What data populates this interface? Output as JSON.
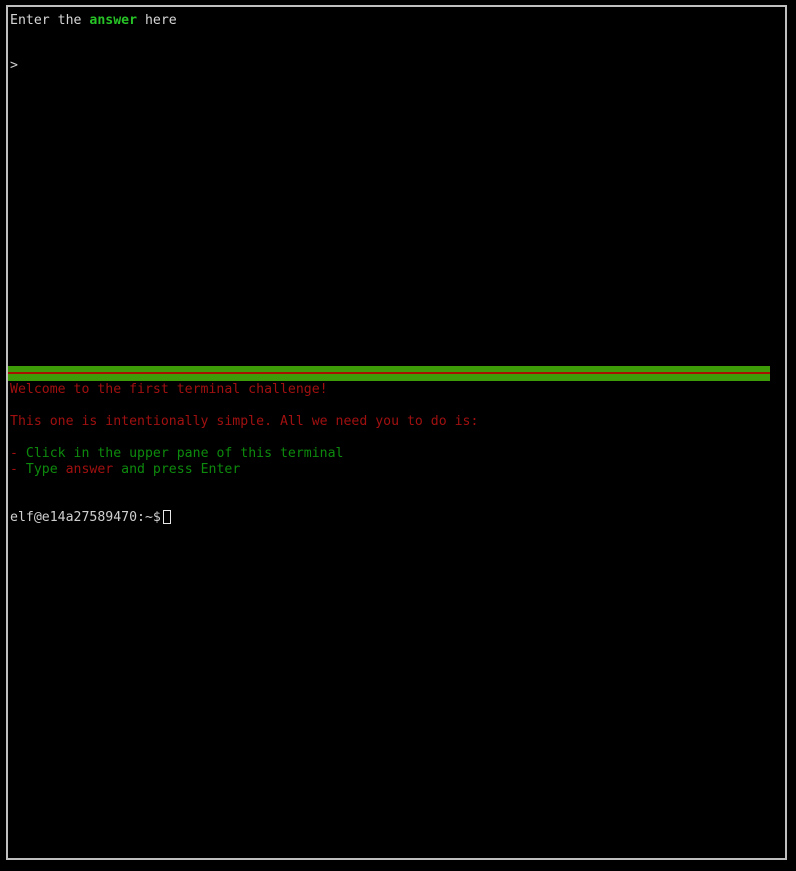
{
  "window": {
    "border_color": "#bfbfbf",
    "background": "#000000"
  },
  "upper_pane": {
    "name": "answer-input-pane",
    "prompt_line": {
      "prefix": "Enter the ",
      "highlight": "answer",
      "suffix": " here"
    },
    "input_caret": ">",
    "input_value": ""
  },
  "separator": {
    "bar_color": "#3e9c08",
    "line_color": "#a81000"
  },
  "lower_pane": {
    "name": "shell-output-pane",
    "lines": [
      {
        "id": "welcome",
        "text": "Welcome to the first terminal challenge!",
        "color": "red"
      },
      {
        "id": "blank-1",
        "text": "",
        "color": "red"
      },
      {
        "id": "intro",
        "text": "This one is intentionally simple. All we need you to do is:",
        "color": "red"
      },
      {
        "id": "blank-2",
        "text": "",
        "color": "red"
      }
    ],
    "bullets": [
      {
        "id": "bullet-click",
        "dash": "-",
        "text": " Click in the upper pane of this terminal"
      },
      {
        "id": "bullet-type",
        "dash": "-",
        "pre": " Type ",
        "keyword": "answer",
        "post": " and press Enter"
      }
    ],
    "shell_prompt": {
      "user": "elf",
      "at": "@",
      "host": "e14a27589470",
      "separator": ":",
      "path": "~",
      "sigil": "$",
      "full": "elf@e14a27589470:~$"
    }
  },
  "colors": {
    "accent_green": "#26c226",
    "dim_green": "#0d8a0d",
    "alert_red": "#a01010",
    "bar_green": "#3e9c08",
    "bar_red": "#a81000",
    "text_white": "#d6d6d6"
  }
}
